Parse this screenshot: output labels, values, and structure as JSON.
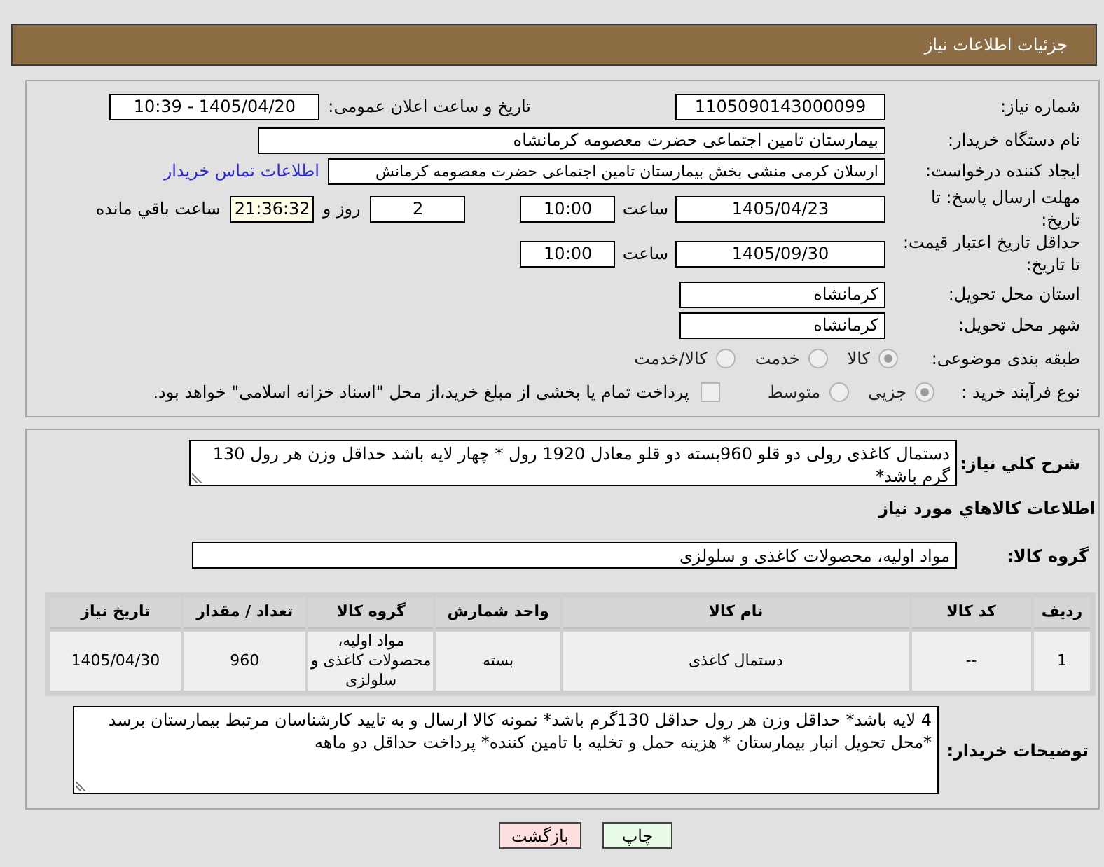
{
  "header": {
    "title": "جزئیات اطلاعات نیاز"
  },
  "details": {
    "need_number": {
      "label": "شماره نیاز:",
      "value": "1105090143000099"
    },
    "announce": {
      "label": "تاریخ و ساعت اعلان عمومی:",
      "value": "1405/04/20 - 10:39"
    },
    "buyer_org": {
      "label": "نام دستگاه خریدار:",
      "value": "بیمارستان تامین اجتماعی حضرت معصومه کرمانشاه"
    },
    "creator": {
      "label": "ایجاد کننده درخواست:",
      "value": "ارسلان کرمی منشی بخش  بیمارستان تامین اجتماعی حضرت معصومه کرمانش",
      "link": "اطلاعات تماس خریدار"
    },
    "deadline": {
      "label": "مهلت ارسال پاسخ: تا تاریخ:",
      "date": "1405/04/23",
      "time_label": "ساعت",
      "time": "10:00",
      "days": "2",
      "days_label": "روز و",
      "remaining": "21:36:32",
      "remaining_label": "ساعت باقي مانده"
    },
    "price_validity": {
      "label": "حداقل تاریخ اعتبار قیمت: تا تاریخ:",
      "date": "1405/09/30",
      "time_label": "ساعت",
      "time": "10:00"
    },
    "province": {
      "label": "استان محل تحویل:",
      "value": "کرمانشاه"
    },
    "city": {
      "label": "شهر محل تحویل:",
      "value": "کرمانشاه"
    },
    "category": {
      "label": "طبقه بندی موضوعی:",
      "options": [
        {
          "label": "کالا",
          "selected": true,
          "disabled": true
        },
        {
          "label": "خدمت",
          "selected": false,
          "disabled": true
        },
        {
          "label": "کالا/خدمت",
          "selected": false,
          "disabled": true
        }
      ]
    },
    "process": {
      "label": "نوع فرآیند خرید :",
      "options": [
        {
          "label": "جزیی",
          "selected": true,
          "disabled": true
        },
        {
          "label": "متوسط",
          "selected": false,
          "disabled": true
        }
      ],
      "treasury": {
        "label": "پرداخت تمام یا بخشی از مبلغ خرید،از محل \"اسناد خزانه اسلامی\" خواهد بود.",
        "checked": false
      }
    }
  },
  "description": {
    "label": "شرح کلي نیاز:",
    "value": "دستمال کاغذی رولی دو قلو 960بسته دو قلو معادل 1920 رول * چهار لایه باشد حداقل وزن هر رول 130 گرم باشد*"
  },
  "goods": {
    "heading": "اطلاعات کالاهاي مورد نیاز",
    "group": {
      "label": "گروه کالا:",
      "value": "مواد اولیه، محصولات کاغذی و سلولزی"
    },
    "table": {
      "columns": [
        "ردیف",
        "کد کالا",
        "نام کالا",
        "واحد شمارش",
        "گروه کالا",
        "تعداد / مقدار",
        "تاریخ نیاز"
      ],
      "rows": [
        [
          "1",
          "--",
          "دستمال کاغذی",
          "بسته",
          "مواد اولیه، محصولات کاغذی و سلولزی",
          "960",
          "1405/04/30"
        ]
      ]
    }
  },
  "buyer_notes": {
    "label": "توضیحات خریدار:",
    "value": "4 لایه باشد* حداقل وزن هر رول حداقل 130گرم باشد* نمونه کالا ارسال و به تایید کارشناسان مرتبط بیمارستان برسد *محل تحویل انبار بیمارستان * هزینه حمل و تخلیه با تامین کننده* پرداخت حداقل دو ماهه"
  },
  "buttons": [
    {
      "label": "چاپ",
      "kind": "print"
    },
    {
      "label": "بازگشت",
      "kind": "back"
    }
  ]
}
